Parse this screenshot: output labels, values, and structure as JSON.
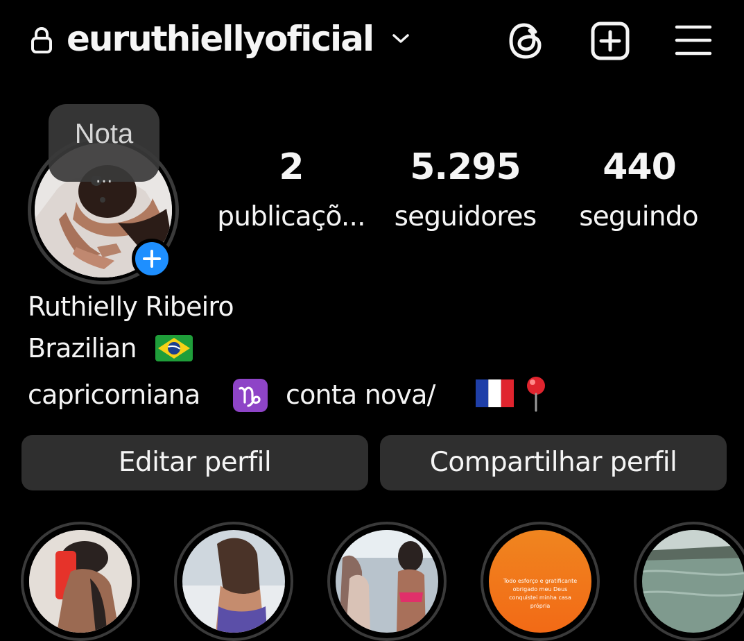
{
  "header": {
    "username": "euruthiellyoficial",
    "icons": [
      "lock-icon",
      "chevron-down-icon",
      "threads-icon",
      "add-post-icon",
      "menu-icon"
    ]
  },
  "note": {
    "label": "Nota",
    "dots": "..."
  },
  "stats": {
    "posts": {
      "value": "2",
      "label": "publicaçõ..."
    },
    "followers": {
      "value": "5.295",
      "label": "seguidores"
    },
    "following": {
      "value": "440",
      "label": "seguindo"
    }
  },
  "bio": {
    "name": "Ruthielly Ribeiro",
    "line2": "Brazilian",
    "line3_a": "capricorniana",
    "line3_b": "conta nova/"
  },
  "buttons": {
    "edit": "Editar perfil",
    "share": "Compartilhar perfil"
  },
  "highlights": {
    "h4_text": "Todo esforço e gratificante obrigado meu Deus conquistei minha casa própria"
  },
  "colors": {
    "background": "#000000",
    "button_bg": "#2f2f2f",
    "accent_blue": "#1e8fff",
    "text": "#f5f5f5"
  }
}
